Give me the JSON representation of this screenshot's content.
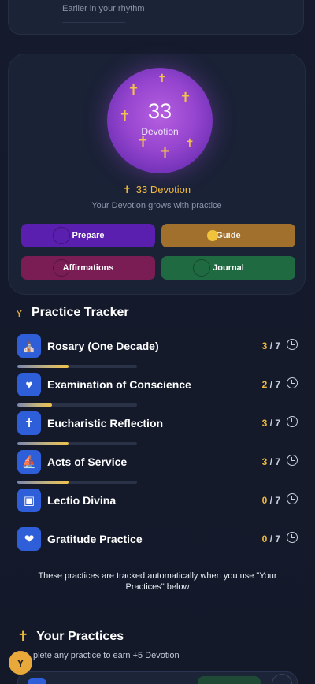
{
  "top_card": {
    "subtitle": "Earlier in your rhythm"
  },
  "devotion": {
    "orb_value": "33",
    "orb_label": "Devotion",
    "title": "33 Devotion",
    "subtitle": "Your Devotion grows with practice",
    "buttons": {
      "prepare": "Prepare",
      "guide": "Guide",
      "affirmations": "Affirmations",
      "journal": "Journal"
    }
  },
  "tracker": {
    "title": "Practice Tracker",
    "items": [
      {
        "name": "Rosary (One Decade)",
        "count": "3",
        "total": " / 7",
        "progress": 0.43,
        "icon": "rosary-icon"
      },
      {
        "name": "Examination of Conscience",
        "count": "2",
        "total": " / 7",
        "progress": 0.29,
        "icon": "heart-icon"
      },
      {
        "name": "Eucharistic Reflection",
        "count": "3",
        "total": " / 7",
        "progress": 0.43,
        "icon": "cross-icon"
      },
      {
        "name": "Acts of Service",
        "count": "3",
        "total": " / 7",
        "progress": 0.43,
        "icon": "service-icon"
      },
      {
        "name": "Lectio Divina",
        "count": "0",
        "total": " / 7",
        "progress": 0,
        "icon": "book-icon"
      },
      {
        "name": "Gratitude Practice",
        "count": "0",
        "total": " / 7",
        "progress": 0,
        "icon": "gratitude-icon"
      }
    ],
    "note": "These practices are tracked automatically when you use \"Your Practices\" below"
  },
  "your_practices": {
    "title": "Your Practices",
    "subtitle": "plete any practice to earn +5 Devotion",
    "avatar_letter": "Y"
  },
  "colors": {
    "accent_gold": "#f0b93c",
    "orb_purple": "#9645cf",
    "icon_blue": "#2f5fd8",
    "prepare": "#5a1fae",
    "guide": "#a0702c",
    "affirmations": "#7a1d55",
    "journal": "#1f6a41"
  }
}
